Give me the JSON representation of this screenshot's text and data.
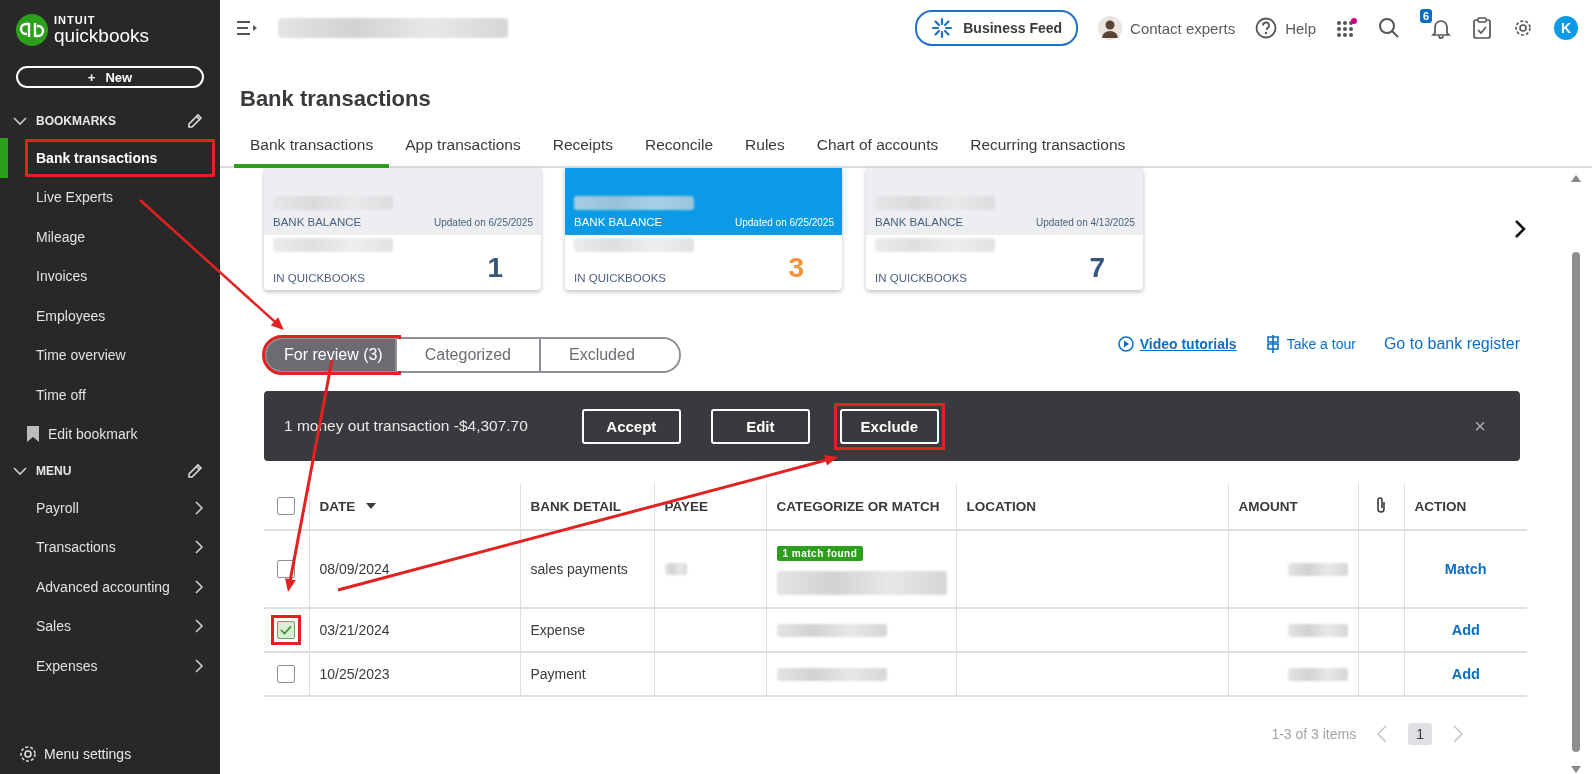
{
  "sidebar": {
    "brand": "INTUIT",
    "product": "quickbooks",
    "new_button": {
      "icon": "+",
      "label": "New"
    },
    "sections": [
      {
        "title": "BOOKMARKS",
        "expanded": true,
        "items": [
          {
            "label": "Bank transactions",
            "kind": "link",
            "selected": true,
            "highlighted": true
          },
          {
            "label": "Live Experts",
            "kind": "link",
            "selected": false,
            "highlighted": false
          },
          {
            "label": "Mileage",
            "kind": "link",
            "selected": false,
            "highlighted": false
          },
          {
            "label": "Invoices",
            "kind": "link",
            "selected": false,
            "highlighted": false
          },
          {
            "label": "Employees",
            "kind": "link",
            "selected": false,
            "highlighted": false
          },
          {
            "label": "Time overview",
            "kind": "link",
            "selected": false,
            "highlighted": false
          },
          {
            "label": "Time off",
            "kind": "link",
            "selected": false,
            "highlighted": false
          },
          {
            "label": "Edit bookmark",
            "kind": "action",
            "selected": false,
            "highlighted": false
          }
        ]
      },
      {
        "title": "MENU",
        "expanded": true,
        "items": [
          {
            "label": "Payroll",
            "kind": "submenu",
            "selected": false,
            "highlighted": false
          },
          {
            "label": "Transactions",
            "kind": "submenu",
            "selected": false,
            "highlighted": false
          },
          {
            "label": "Advanced accounting",
            "kind": "submenu",
            "selected": false,
            "highlighted": false
          },
          {
            "label": "Sales",
            "kind": "submenu",
            "selected": false,
            "highlighted": false
          },
          {
            "label": "Expenses",
            "kind": "submenu",
            "selected": false,
            "highlighted": false
          }
        ]
      }
    ],
    "footer": "Menu settings"
  },
  "topbar": {
    "business_feed": "Business Feed",
    "contact": "Contact experts",
    "help": "Help",
    "notifications": "6",
    "avatar": "K"
  },
  "page_title": "Bank transactions",
  "tabs": [
    {
      "label": "Bank transactions",
      "selected": true
    },
    {
      "label": "App transactions",
      "selected": false
    },
    {
      "label": "Receipts",
      "selected": false
    },
    {
      "label": "Reconcile",
      "selected": false
    },
    {
      "label": "Rules",
      "selected": false
    },
    {
      "label": "Chart of accounts",
      "selected": false
    },
    {
      "label": "Recurring transactions",
      "selected": false
    }
  ],
  "accounts": [
    {
      "balance_label": "BANK BALANCE",
      "updated": "Updated on 6/25/2025",
      "books_label": "IN QUICKBOOKS",
      "count": "1",
      "selected": false
    },
    {
      "balance_label": "BANK BALANCE",
      "updated": "Updated on 6/25/2025",
      "books_label": "IN QUICKBOOKS",
      "count": "3",
      "selected": true
    },
    {
      "balance_label": "BANK BALANCE",
      "updated": "Updated on 4/13/2025",
      "books_label": "IN QUICKBOOKS",
      "count": "7",
      "selected": false
    }
  ],
  "filters": [
    {
      "label": "For review (3)",
      "selected": true,
      "highlighted": true
    },
    {
      "label": "Categorized",
      "selected": false,
      "highlighted": false
    },
    {
      "label": "Excluded",
      "selected": false,
      "highlighted": false
    }
  ],
  "links": [
    {
      "label": "Video tutorials",
      "kind": "video"
    },
    {
      "label": "Take a tour",
      "kind": "tour"
    },
    {
      "label": "Go to bank register",
      "kind": "plain"
    }
  ],
  "batch_bar": {
    "text": "1 money out transaction -$4,307.70",
    "buttons": [
      {
        "label": "Accept",
        "highlighted": false
      },
      {
        "label": "Edit",
        "highlighted": false
      },
      {
        "label": "Exclude",
        "highlighted": true
      }
    ],
    "close": "×"
  },
  "table": {
    "select_all": {
      "checked": false
    },
    "columns": [
      {
        "label": "DATE",
        "sorted": true
      },
      {
        "label": "BANK DETAIL",
        "sorted": false
      },
      {
        "label": "PAYEE",
        "sorted": false
      },
      {
        "label": "CATEGORIZE OR MATCH",
        "sorted": false
      },
      {
        "label": "LOCATION",
        "sorted": false
      },
      {
        "label": "AMOUNT",
        "sorted": false
      },
      {
        "label": "ACTION",
        "sorted": false
      }
    ],
    "rows": [
      {
        "checked": false,
        "highlighted": false,
        "date": "08/09/2024",
        "bank_detail": "sales payments",
        "match_badge": "1 match found",
        "action": "Match"
      },
      {
        "checked": true,
        "highlighted": true,
        "date": "03/21/2024",
        "bank_detail": "Expense",
        "action": "Add"
      },
      {
        "checked": false,
        "highlighted": false,
        "date": "10/25/2023",
        "bank_detail": "Payment",
        "action": "Add"
      }
    ]
  },
  "pager": {
    "summary": "1-3 of 3 items",
    "page": "1"
  }
}
